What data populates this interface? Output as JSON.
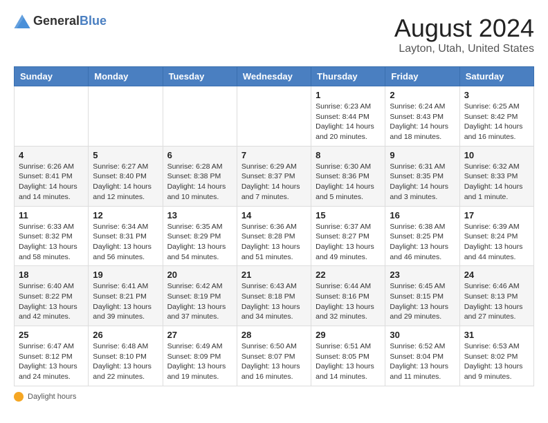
{
  "header": {
    "logo_general": "General",
    "logo_blue": "Blue",
    "month_year": "August 2024",
    "location": "Layton, Utah, United States"
  },
  "days_of_week": [
    "Sunday",
    "Monday",
    "Tuesday",
    "Wednesday",
    "Thursday",
    "Friday",
    "Saturday"
  ],
  "footer": {
    "daylight_label": "Daylight hours"
  },
  "weeks": [
    {
      "days": [
        {
          "number": "",
          "info": ""
        },
        {
          "number": "",
          "info": ""
        },
        {
          "number": "",
          "info": ""
        },
        {
          "number": "",
          "info": ""
        },
        {
          "number": "1",
          "info": "Sunrise: 6:23 AM\nSunset: 8:44 PM\nDaylight: 14 hours and 20 minutes."
        },
        {
          "number": "2",
          "info": "Sunrise: 6:24 AM\nSunset: 8:43 PM\nDaylight: 14 hours and 18 minutes."
        },
        {
          "number": "3",
          "info": "Sunrise: 6:25 AM\nSunset: 8:42 PM\nDaylight: 14 hours and 16 minutes."
        }
      ]
    },
    {
      "days": [
        {
          "number": "4",
          "info": "Sunrise: 6:26 AM\nSunset: 8:41 PM\nDaylight: 14 hours and 14 minutes."
        },
        {
          "number": "5",
          "info": "Sunrise: 6:27 AM\nSunset: 8:40 PM\nDaylight: 14 hours and 12 minutes."
        },
        {
          "number": "6",
          "info": "Sunrise: 6:28 AM\nSunset: 8:38 PM\nDaylight: 14 hours and 10 minutes."
        },
        {
          "number": "7",
          "info": "Sunrise: 6:29 AM\nSunset: 8:37 PM\nDaylight: 14 hours and 7 minutes."
        },
        {
          "number": "8",
          "info": "Sunrise: 6:30 AM\nSunset: 8:36 PM\nDaylight: 14 hours and 5 minutes."
        },
        {
          "number": "9",
          "info": "Sunrise: 6:31 AM\nSunset: 8:35 PM\nDaylight: 14 hours and 3 minutes."
        },
        {
          "number": "10",
          "info": "Sunrise: 6:32 AM\nSunset: 8:33 PM\nDaylight: 14 hours and 1 minute."
        }
      ]
    },
    {
      "days": [
        {
          "number": "11",
          "info": "Sunrise: 6:33 AM\nSunset: 8:32 PM\nDaylight: 13 hours and 58 minutes."
        },
        {
          "number": "12",
          "info": "Sunrise: 6:34 AM\nSunset: 8:31 PM\nDaylight: 13 hours and 56 minutes."
        },
        {
          "number": "13",
          "info": "Sunrise: 6:35 AM\nSunset: 8:29 PM\nDaylight: 13 hours and 54 minutes."
        },
        {
          "number": "14",
          "info": "Sunrise: 6:36 AM\nSunset: 8:28 PM\nDaylight: 13 hours and 51 minutes."
        },
        {
          "number": "15",
          "info": "Sunrise: 6:37 AM\nSunset: 8:27 PM\nDaylight: 13 hours and 49 minutes."
        },
        {
          "number": "16",
          "info": "Sunrise: 6:38 AM\nSunset: 8:25 PM\nDaylight: 13 hours and 46 minutes."
        },
        {
          "number": "17",
          "info": "Sunrise: 6:39 AM\nSunset: 8:24 PM\nDaylight: 13 hours and 44 minutes."
        }
      ]
    },
    {
      "days": [
        {
          "number": "18",
          "info": "Sunrise: 6:40 AM\nSunset: 8:22 PM\nDaylight: 13 hours and 42 minutes."
        },
        {
          "number": "19",
          "info": "Sunrise: 6:41 AM\nSunset: 8:21 PM\nDaylight: 13 hours and 39 minutes."
        },
        {
          "number": "20",
          "info": "Sunrise: 6:42 AM\nSunset: 8:19 PM\nDaylight: 13 hours and 37 minutes."
        },
        {
          "number": "21",
          "info": "Sunrise: 6:43 AM\nSunset: 8:18 PM\nDaylight: 13 hours and 34 minutes."
        },
        {
          "number": "22",
          "info": "Sunrise: 6:44 AM\nSunset: 8:16 PM\nDaylight: 13 hours and 32 minutes."
        },
        {
          "number": "23",
          "info": "Sunrise: 6:45 AM\nSunset: 8:15 PM\nDaylight: 13 hours and 29 minutes."
        },
        {
          "number": "24",
          "info": "Sunrise: 6:46 AM\nSunset: 8:13 PM\nDaylight: 13 hours and 27 minutes."
        }
      ]
    },
    {
      "days": [
        {
          "number": "25",
          "info": "Sunrise: 6:47 AM\nSunset: 8:12 PM\nDaylight: 13 hours and 24 minutes."
        },
        {
          "number": "26",
          "info": "Sunrise: 6:48 AM\nSunset: 8:10 PM\nDaylight: 13 hours and 22 minutes."
        },
        {
          "number": "27",
          "info": "Sunrise: 6:49 AM\nSunset: 8:09 PM\nDaylight: 13 hours and 19 minutes."
        },
        {
          "number": "28",
          "info": "Sunrise: 6:50 AM\nSunset: 8:07 PM\nDaylight: 13 hours and 16 minutes."
        },
        {
          "number": "29",
          "info": "Sunrise: 6:51 AM\nSunset: 8:05 PM\nDaylight: 13 hours and 14 minutes."
        },
        {
          "number": "30",
          "info": "Sunrise: 6:52 AM\nSunset: 8:04 PM\nDaylight: 13 hours and 11 minutes."
        },
        {
          "number": "31",
          "info": "Sunrise: 6:53 AM\nSunset: 8:02 PM\nDaylight: 13 hours and 9 minutes."
        }
      ]
    }
  ]
}
